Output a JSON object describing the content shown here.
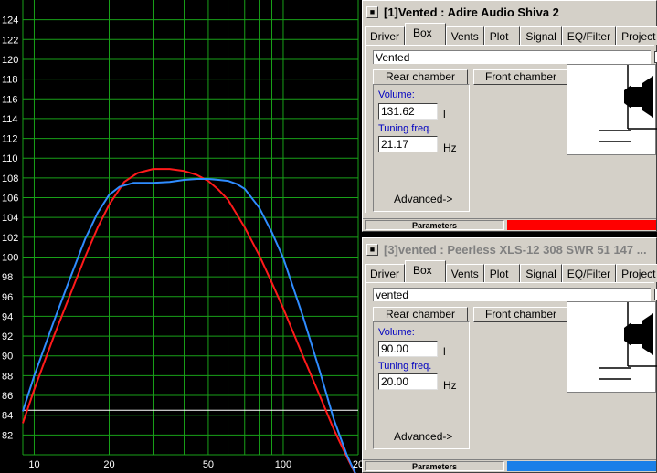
{
  "chart_data": {
    "type": "line",
    "x_scale": "log",
    "xlim": [
      9,
      200
    ],
    "ylim": [
      80,
      126
    ],
    "x_ticks": [
      10,
      20,
      50,
      100,
      200
    ],
    "x_tick_labels": [
      "10",
      "20",
      "50",
      "100",
      "20"
    ],
    "y_ticks": [
      82,
      84,
      86,
      88,
      90,
      92,
      94,
      96,
      98,
      100,
      102,
      104,
      106,
      108,
      110,
      112,
      114,
      116,
      118,
      120,
      122,
      124
    ],
    "grid": true,
    "reference_line_y": 84.5,
    "series": [
      {
        "color": "#ff1a1a",
        "x": [
          9,
          10,
          12,
          14,
          16,
          18,
          20,
          23,
          26,
          30,
          35,
          40,
          45,
          50,
          55,
          60,
          70,
          80,
          90,
          100,
          120,
          140,
          160,
          180,
          200
        ],
        "y": [
          83.2,
          86.6,
          92.0,
          96.3,
          100.0,
          103.0,
          105.3,
          107.6,
          108.5,
          108.9,
          108.9,
          108.7,
          108.3,
          107.7,
          106.8,
          105.8,
          103.0,
          100.2,
          97.4,
          94.8,
          90.0,
          86.0,
          82.5,
          79.8,
          77.5
        ]
      },
      {
        "color": "#2f8cff",
        "x": [
          9,
          10,
          12,
          14,
          16,
          18,
          20,
          22,
          25,
          30,
          35,
          40,
          45,
          50,
          55,
          60,
          65,
          70,
          80,
          90,
          100,
          120,
          140,
          160,
          180,
          200
        ],
        "y": [
          84.4,
          88.0,
          93.5,
          98.0,
          101.8,
          104.5,
          106.3,
          107.1,
          107.5,
          107.5,
          107.6,
          107.8,
          107.9,
          107.9,
          107.8,
          107.7,
          107.4,
          106.9,
          105.0,
          102.5,
          99.9,
          94.0,
          88.5,
          83.5,
          80.0,
          77.5
        ]
      }
    ]
  },
  "colors": {
    "red_curve": "#ff1a1a",
    "blue_curve": "#2f8cff",
    "grid": "#18a018"
  },
  "win1": {
    "title": "[1]Vented : Adire Audio Shiva 2",
    "tabs": [
      "Driver",
      "Box",
      "Vents",
      "Plot",
      "Signal",
      "EQ/Filter",
      "Project"
    ],
    "active_tab": "Box",
    "box_type": "Vented",
    "rear_chamber": "Rear chamber",
    "front_chamber": "Front chamber",
    "volume_label": "Volume:",
    "volume_value": "131.62",
    "volume_unit": "l",
    "tuning_label": "Tuning freq.",
    "tuning_value": "21.17",
    "tuning_unit": "Hz",
    "advanced": "Advanced->",
    "status_label": "Parameters",
    "status_color": "#ff0000"
  },
  "win2": {
    "title": "[3]vented : Peerless XLS-12 308 SWR 51 147 ...",
    "tabs": [
      "Driver",
      "Box",
      "Vents",
      "Plot",
      "Signal",
      "EQ/Filter",
      "Project"
    ],
    "active_tab": "Box",
    "box_type": "vented",
    "rear_chamber": "Rear chamber",
    "front_chamber": "Front chamber",
    "volume_label": "Volume:",
    "volume_value": "90.00",
    "volume_unit": "l",
    "tuning_label": "Tuning freq.",
    "tuning_value": "20.00",
    "tuning_unit": "Hz",
    "advanced": "Advanced->",
    "status_label": "Parameters",
    "status_color": "#1a7fe8"
  }
}
